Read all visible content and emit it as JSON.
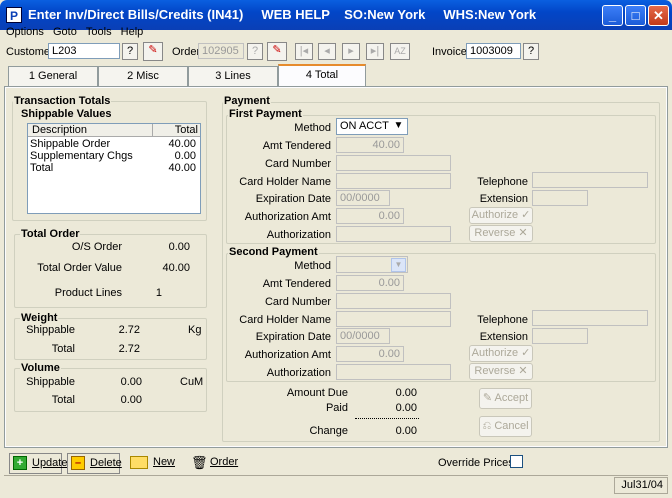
{
  "title": "Enter Inv/Direct Bills/Credits (IN41)     WEB HELP    SO:New York     WHS:New York",
  "menu": [
    "Options",
    "Goto",
    "Tools",
    "Help"
  ],
  "header": {
    "customer_label": "Customer",
    "customer_value": "L203",
    "order_label": "Order",
    "order_value": "102905",
    "invoice_label": "Invoice",
    "invoice_value": "1003009",
    "lookup": "?"
  },
  "tabs": [
    "1 General",
    "2 Misc",
    "3 Lines",
    "4 Total"
  ],
  "transaction": {
    "title": "Transaction Totals",
    "shippable_title": "Shippable Values",
    "col_desc": "Description",
    "col_total": "Total",
    "rows": [
      {
        "desc": "Shippable Order",
        "total": "40.00"
      },
      {
        "desc": "Supplementary Chgs",
        "total": "0.00"
      },
      {
        "desc": "Total",
        "total": "40.00"
      }
    ]
  },
  "total_order": {
    "title": "Total Order",
    "os_label": "O/S Order",
    "os_value": "0.00",
    "tov_label": "Total Order Value",
    "tov_value": "40.00",
    "pl_label": "Product Lines",
    "pl_value": "1"
  },
  "weight": {
    "title": "Weight",
    "ship_label": "Shippable",
    "ship_value": "2.72",
    "unit": "Kg",
    "total_label": "Total",
    "total_value": "2.72"
  },
  "volume": {
    "title": "Volume",
    "ship_label": "Shippable",
    "ship_value": "0.00",
    "unit": "CuM",
    "total_label": "Total",
    "total_value": "0.00"
  },
  "payment": {
    "title": "Payment",
    "first": {
      "title": "First Payment",
      "method_label": "Method",
      "method_value": "ON ACCT",
      "amt_label": "Amt Tendered",
      "amt_value": "40.00",
      "card_label": "Card Number",
      "holder_label": "Card Holder Name",
      "tel_label": "Telephone",
      "exp_label": "Expiration Date",
      "exp_value": "00/0000",
      "ext_label": "Extension",
      "auth_amt_label": "Authorization Amt",
      "auth_amt_value": "0.00",
      "auth_label": "Authorization",
      "authorize_btn": "Authorize",
      "reverse_btn": "Reverse"
    },
    "second": {
      "title": "Second Payment",
      "method_label": "Method",
      "method_value": "",
      "amt_label": "Amt Tendered",
      "amt_value": "0.00",
      "card_label": "Card Number",
      "holder_label": "Card Holder Name",
      "tel_label": "Telephone",
      "exp_label": "Expiration Date",
      "exp_value": "00/0000",
      "ext_label": "Extension",
      "auth_amt_label": "Authorization Amt",
      "auth_amt_value": "0.00",
      "auth_label": "Authorization",
      "authorize_btn": "Authorize",
      "reverse_btn": "Reverse"
    },
    "amount_due_label": "Amount Due",
    "amount_due_value": "0.00",
    "paid_label": "Paid",
    "paid_value": "0.00",
    "change_label": "Change",
    "change_value": "0.00",
    "accept_btn": "Accept",
    "cancel_btn": "Cancel"
  },
  "bottom": {
    "update": "Update",
    "delete": "Delete",
    "new": "New",
    "order": "Order",
    "override_label": "Override Prices"
  },
  "status": {
    "date": "Jul31/04"
  }
}
